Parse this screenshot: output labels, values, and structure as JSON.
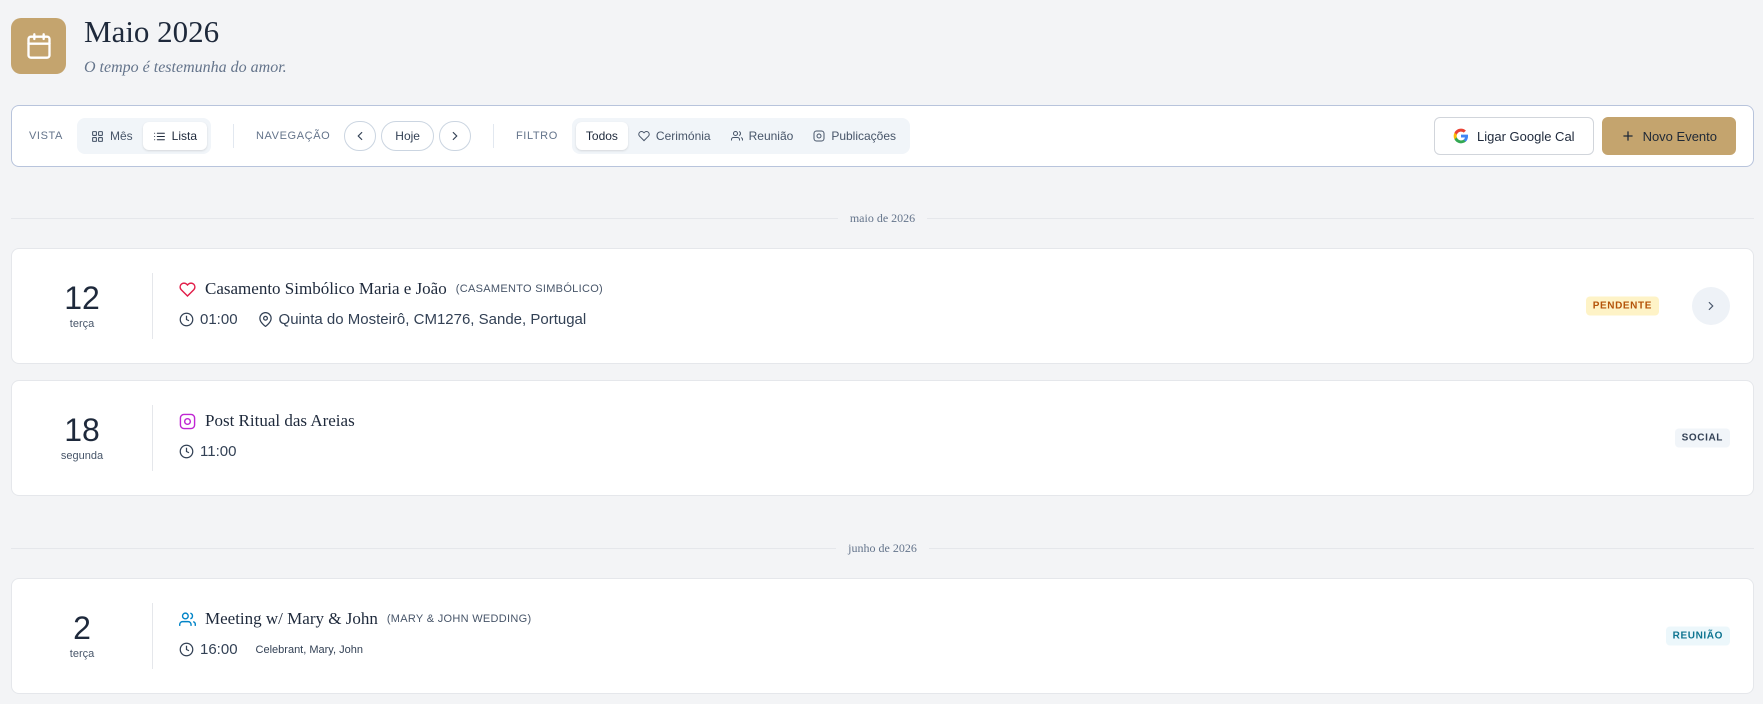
{
  "header": {
    "title": "Maio 2026",
    "subtitle": "O tempo é testemunha do amor."
  },
  "toolbar": {
    "view_label": "VISTA",
    "view_options": [
      {
        "label": "Mês",
        "active": false
      },
      {
        "label": "Lista",
        "active": true
      }
    ],
    "nav_label": "NAVEGAÇÃO",
    "today_label": "Hoje",
    "filter_label": "FILTRO",
    "filter_options": [
      {
        "label": "Todos",
        "active": true
      },
      {
        "label": "Cerimónia",
        "active": false
      },
      {
        "label": "Reunião",
        "active": false
      },
      {
        "label": "Publicações",
        "active": false
      }
    ],
    "gcal_label": "Ligar Google Cal",
    "new_event_label": "Novo Evento"
  },
  "months": [
    {
      "label": "maio de 2026",
      "events": [
        {
          "day": "12",
          "weekday": "terça",
          "icon": "heart-icon",
          "title": "Casamento Simbólico Maria e João",
          "tag": "(CASAMENTO SIMBÓLICO)",
          "time": "01:00",
          "location": "Quinta do Mosteirô, CM1276, Sande, Portugal",
          "badge": "PENDENTE"
        },
        {
          "day": "18",
          "weekday": "segunda",
          "icon": "instagram-icon",
          "title": "Post Ritual das Areias",
          "time": "11:00",
          "badge": "SOCIAL"
        }
      ]
    },
    {
      "label": "junho de 2026",
      "events": [
        {
          "day": "2",
          "weekday": "terça",
          "icon": "users-icon",
          "title": "Meeting w/ Mary & John",
          "tag": "(MARY & JOHN WEDDING)",
          "time": "16:00",
          "people": "Celebrant, Mary, John",
          "badge": "REUNIÃO"
        }
      ]
    }
  ],
  "colors": {
    "accent": "#c4a46e",
    "heart": "#e11d48",
    "instagram": "#c026d3",
    "users": "#0284c7",
    "pending_bg": "#fef3c7",
    "pending_text": "#b45309"
  }
}
